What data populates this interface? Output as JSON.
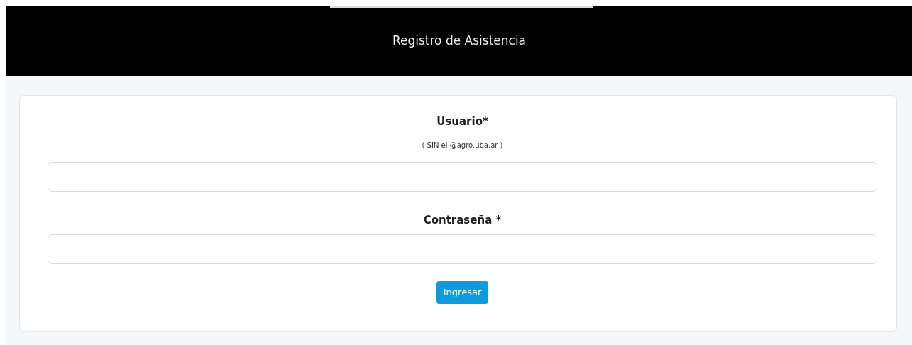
{
  "header": {
    "title": "Registro de Asistencia"
  },
  "form": {
    "fields": [
      {
        "label": "Usuario*",
        "hint": "( SIN el @agro.uba.ar )"
      },
      {
        "label": "Contraseña *"
      }
    ],
    "submit": "Ingresar"
  }
}
